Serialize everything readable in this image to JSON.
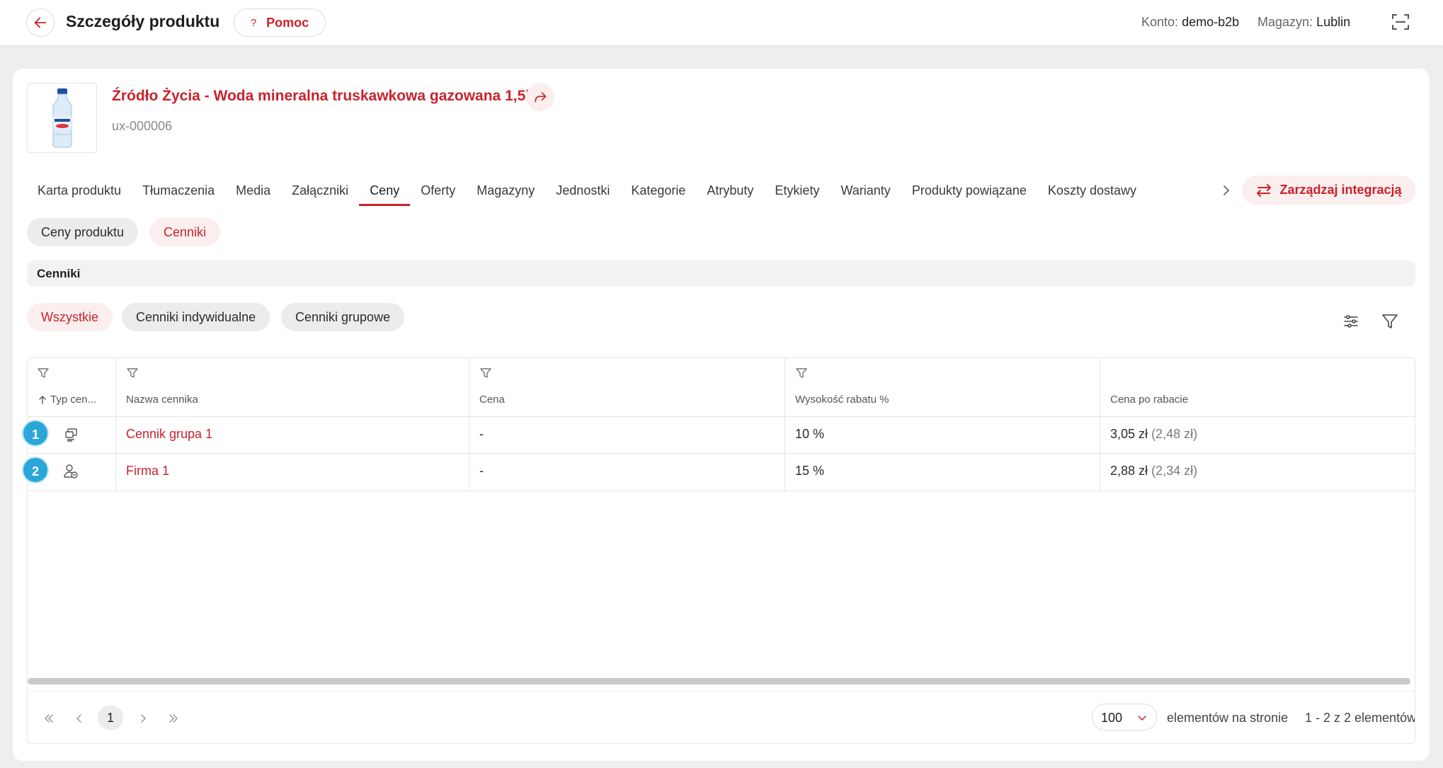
{
  "header": {
    "title": "Szczegóły produktu",
    "help_label": "Pomoc",
    "account_label": "Konto:",
    "account_value": "demo-b2b",
    "warehouse_label": "Magazyn:",
    "warehouse_value": "Lublin"
  },
  "product": {
    "name": "Źródło Życia - Woda mineralna truskawkowa gazowana 1,5l",
    "sku": "ux-000006"
  },
  "tabs": [
    "Karta produktu",
    "Tłumaczenia",
    "Media",
    "Załączniki",
    "Ceny",
    "Oferty",
    "Magazyny",
    "Jednostki",
    "Kategorie",
    "Atrybuty",
    "Etykiety",
    "Warianty",
    "Produkty powiązane",
    "Koszty dostawy"
  ],
  "active_tab": "Ceny",
  "integration_label": "Zarządzaj integracją",
  "price_subtabs": [
    "Ceny produktu",
    "Cenniki"
  ],
  "section_title": "Cenniki",
  "filters": [
    "Wszystkie",
    "Cenniki indywidualne",
    "Cenniki grupowe"
  ],
  "table": {
    "columns": [
      "Typ cen...",
      "Nazwa cennika",
      "Cena",
      "Wysokość rabatu %",
      "Cena po rabacie"
    ],
    "rows": [
      {
        "type_icon": "group-pricelist-icon",
        "name": "Cennik grupa 1",
        "price": "-",
        "discount": "10 %",
        "after_gross": "3,05 zł",
        "after_net": "(2,48 zł)"
      },
      {
        "type_icon": "individual-pricelist-icon",
        "name": "Firma 1",
        "price": "-",
        "discount": "15 %",
        "after_gross": "2,88 zł",
        "after_net": "(2,34 zł)"
      }
    ]
  },
  "pagination": {
    "current_page": "1",
    "per_page": "100",
    "per_page_label": "elementów na stronie",
    "summary": "1 - 2 z 2 elementów"
  },
  "badges": [
    "1",
    "2"
  ],
  "colors": {
    "accent": "#c8232c",
    "badge": "#2aa7d9"
  }
}
